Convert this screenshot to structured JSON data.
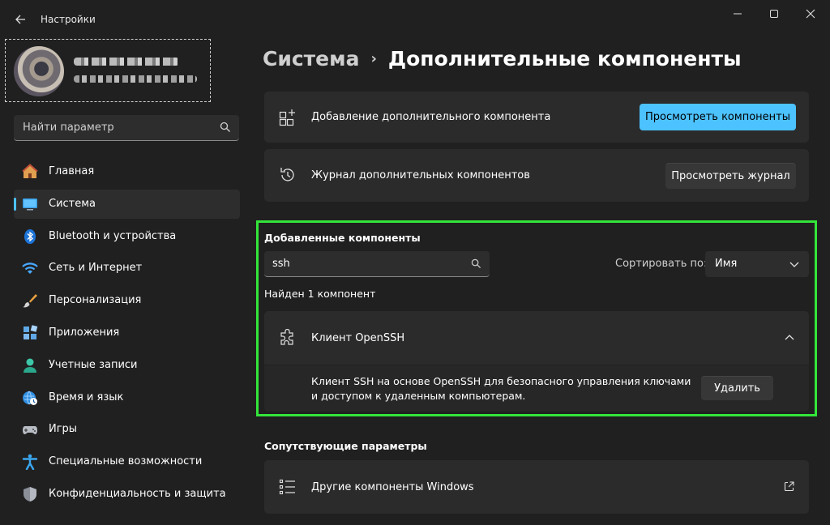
{
  "window": {
    "title": "Настройки"
  },
  "search": {
    "placeholder": "Найти параметр"
  },
  "sidebar": {
    "items": [
      {
        "label": "Главная",
        "icon": "home-icon"
      },
      {
        "label": "Система",
        "icon": "monitor-icon",
        "active": true
      },
      {
        "label": "Bluetooth и устройства",
        "icon": "bluetooth-icon"
      },
      {
        "label": "Сеть и Интернет",
        "icon": "wifi-icon"
      },
      {
        "label": "Персонализация",
        "icon": "brush-icon"
      },
      {
        "label": "Приложения",
        "icon": "apps-icon"
      },
      {
        "label": "Учетные записи",
        "icon": "person-icon"
      },
      {
        "label": "Время и язык",
        "icon": "globe-clock-icon"
      },
      {
        "label": "Игры",
        "icon": "gamepad-icon"
      },
      {
        "label": "Специальные возможности",
        "icon": "accessibility-icon"
      },
      {
        "label": "Конфиденциальность и защита",
        "icon": "shield-icon"
      }
    ]
  },
  "breadcrumb": {
    "parent": "Система",
    "separator": "›",
    "current": "Дополнительные компоненты"
  },
  "add_card": {
    "label": "Добавление дополнительного компонента",
    "button": "Просмотреть компоненты"
  },
  "history_card": {
    "label": "Журнал дополнительных компонентов",
    "button": "Просмотреть журнал"
  },
  "installed": {
    "title": "Добавленные компоненты",
    "filter_value": "ssh",
    "sort_label": "Сортировать по:",
    "sort_value": "Имя",
    "found_text": "Найден 1 компонент",
    "item": {
      "name": "Клиент OpenSSH",
      "description_line1": "Клиент SSH на основе OpenSSH для безопасного управления ключами",
      "description_line2": "и доступом к удаленным компьютерам.",
      "remove_button": "Удалить"
    }
  },
  "related": {
    "title": "Сопутствующие параметры",
    "item_label": "Другие компоненты Windows"
  },
  "colors": {
    "accent": "#4cc2ff",
    "highlight": "#33e53a",
    "background": "#202020",
    "card": "#2b2b2b"
  }
}
